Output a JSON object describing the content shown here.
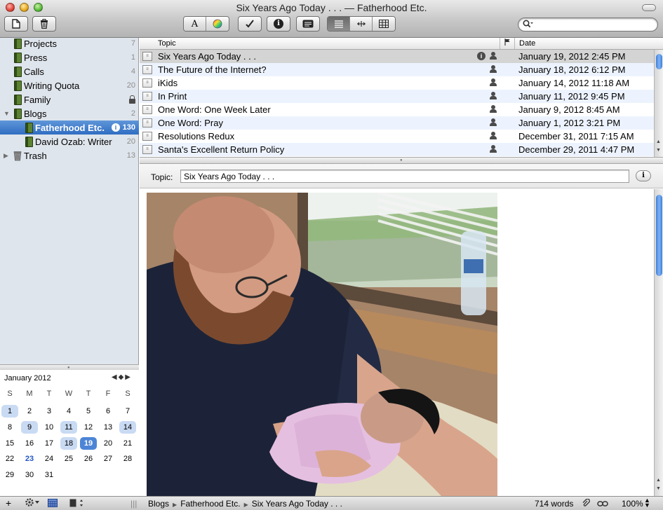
{
  "window": {
    "title": "Six Years Ago Today . . . — Fatherhood Etc."
  },
  "toolbar": {
    "new_icon": "new-document-icon",
    "trash_icon": "trash-icon",
    "font_label": "A",
    "info_label": "i",
    "view_modes": [
      "outline-view-icon",
      "split-view-icon",
      "grid-view-icon"
    ]
  },
  "search": {
    "placeholder": "",
    "value": ""
  },
  "sidebar": {
    "items": [
      {
        "label": "Projects",
        "count": "7"
      },
      {
        "label": "Press",
        "count": "1"
      },
      {
        "label": "Calls",
        "count": "4"
      },
      {
        "label": "Writing Quota",
        "count": "20"
      },
      {
        "label": "Family",
        "count": ""
      },
      {
        "label": "Blogs",
        "count": "2"
      },
      {
        "label": "Fatherhood Etc.",
        "count": "130"
      },
      {
        "label": "David Ozab: Writer",
        "count": "20"
      },
      {
        "label": "Trash",
        "count": "13"
      }
    ]
  },
  "calendar": {
    "month_label": "January 2012",
    "nav": "◀◆▶",
    "weekdays": [
      "S",
      "M",
      "T",
      "W",
      "T",
      "F",
      "S"
    ],
    "days": [
      "1",
      "2",
      "3",
      "4",
      "5",
      "6",
      "7",
      "8",
      "9",
      "10",
      "11",
      "12",
      "13",
      "14",
      "15",
      "16",
      "17",
      "18",
      "19",
      "20",
      "21",
      "22",
      "23",
      "24",
      "25",
      "26",
      "27",
      "28",
      "29",
      "30",
      "31"
    ],
    "highlighted": [
      "1",
      "9",
      "11",
      "14",
      "18"
    ],
    "selected": "19",
    "today": "23"
  },
  "list": {
    "columns": {
      "topic": "Topic",
      "date": "Date"
    },
    "rows": [
      {
        "topic": "Six Years Ago Today . . .",
        "date": "January 19, 2012 2:45 PM",
        "has_info": true
      },
      {
        "topic": "The Future of the Internet?",
        "date": "January 18, 2012 6:12 PM",
        "has_info": false
      },
      {
        "topic": "iKids",
        "date": "January 14, 2012 11:18 AM",
        "has_info": false
      },
      {
        "topic": "In Print",
        "date": "January 11, 2012 9:45 PM",
        "has_info": false
      },
      {
        "topic": "One Word: One Week Later",
        "date": "January 9, 2012 8:45 AM",
        "has_info": false
      },
      {
        "topic": "One Word: Pray",
        "date": "January 1, 2012 3:21 PM",
        "has_info": false
      },
      {
        "topic": "Resolutions Redux",
        "date": "December 31, 2011 7:15 AM",
        "has_info": false
      },
      {
        "topic": "Santa's Excellent Return Policy",
        "date": "December 29, 2011 4:47 PM",
        "has_info": false
      }
    ]
  },
  "editor": {
    "topic_label": "Topic:",
    "topic_value": "Six Years Ago Today . . .",
    "photo_icon": "father-holding-newborn-photo"
  },
  "statusbar": {
    "breadcrumb": [
      "Blogs",
      "Fatherhood Etc.",
      "Six Years Ago Today . . ."
    ],
    "word_count": "714 words",
    "zoom": "100%"
  },
  "colors": {
    "selection": "#2f6dc2",
    "row_alt": "#edf3fe",
    "sidebar_bg": "#dfe5ec"
  }
}
